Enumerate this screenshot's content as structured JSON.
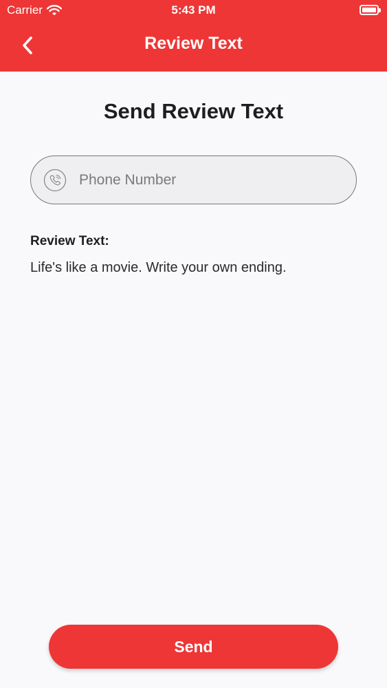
{
  "status_bar": {
    "carrier": "Carrier",
    "time": "5:43 PM",
    "wifi_icon": "wifi-icon",
    "battery_icon": "battery-icon"
  },
  "nav": {
    "title": "Review Text",
    "back_icon": "chevron-left-icon"
  },
  "main": {
    "title": "Send Review Text",
    "phone_field": {
      "placeholder": "Phone Number",
      "value": "",
      "icon": "phone-icon"
    },
    "review_label": "Review Text:",
    "review_body": "Life's like a movie. Write your own ending."
  },
  "footer": {
    "send_label": "Send"
  },
  "colors": {
    "accent": "#ee3636",
    "background": "#f9f9fb",
    "field_background": "#efeff1"
  }
}
